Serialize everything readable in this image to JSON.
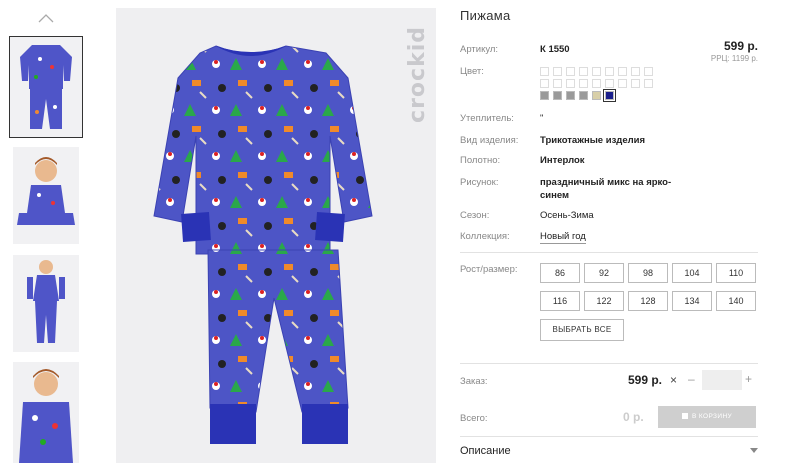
{
  "thumbnails": {
    "items": [
      {
        "alt": "pajama-front"
      },
      {
        "alt": "child-sitting"
      },
      {
        "alt": "child-standing"
      },
      {
        "alt": "child-portrait"
      }
    ]
  },
  "brand": {
    "logo_text": "crockid"
  },
  "product": {
    "title": "Пижама",
    "price": "599 р.",
    "rrp": "РРЦ: 1199 р.",
    "rows": {
      "article": {
        "label": "Артикул:",
        "value": "К 1550"
      },
      "color": {
        "label": "Цвет:"
      },
      "insulation": {
        "label": "Утеплитель:",
        "value": "\""
      },
      "type": {
        "label": "Вид изделия:",
        "value": "Трикотажные изделия"
      },
      "fabric": {
        "label": "Полотно:",
        "value": "Интерлок"
      },
      "pattern": {
        "label": "Рисунок:",
        "value_line1": "праздничный микс на ярко-",
        "value_line2": "синем"
      },
      "season": {
        "label": "Сезон:",
        "value": "Осень-Зима"
      },
      "collection": {
        "label": "Коллекция:",
        "value": "Новый год"
      }
    },
    "colors": {
      "selected_color": "#1b1f8c",
      "filled": [
        "#9a9a9a",
        "#9a9a9a",
        "#9a9a9a",
        "#9a9a9a",
        "#d8cfa8",
        "#1b1f8c"
      ]
    },
    "sizes": {
      "label": "Рост/размер:",
      "options": [
        "86",
        "92",
        "98",
        "104",
        "110",
        "116",
        "122",
        "128",
        "134",
        "140"
      ],
      "select_all": "ВЫБРАТЬ ВСЕ"
    },
    "order": {
      "label": "Заказ:",
      "price": "599 р.",
      "times": "×",
      "minus": "–",
      "qty": "",
      "plus": "+"
    },
    "total": {
      "label": "Всего:",
      "price": "0 р.",
      "cart_button": "В КОРЗИНУ"
    },
    "description": {
      "label": "Описание"
    }
  }
}
